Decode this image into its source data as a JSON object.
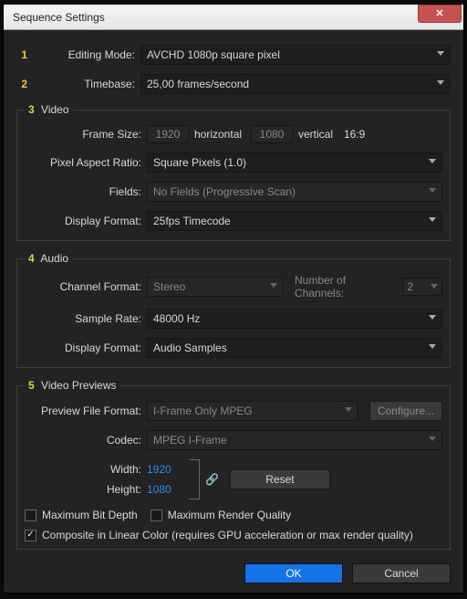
{
  "window": {
    "title": "Sequence Settings"
  },
  "markers": {
    "m1": "1",
    "m2": "2",
    "m3": "3",
    "m4": "4",
    "m5": "5"
  },
  "editing_mode": {
    "label": "Editing Mode:",
    "value": "AVCHD 1080p square pixel"
  },
  "timebase": {
    "label": "Timebase:",
    "value": "25,00 frames/second"
  },
  "video": {
    "legend": "Video",
    "frame_size": {
      "label": "Frame Size:",
      "w": "1920",
      "h": "1080",
      "horizontal": "horizontal",
      "vertical": "vertical",
      "aspect": "16:9"
    },
    "par": {
      "label": "Pixel Aspect Ratio:",
      "value": "Square Pixels (1.0)"
    },
    "fields": {
      "label": "Fields:",
      "value": "No Fields (Progressive Scan)"
    },
    "display_format": {
      "label": "Display Format:",
      "value": "25fps Timecode"
    }
  },
  "audio": {
    "legend": "Audio",
    "channel_format": {
      "label": "Channel Format:",
      "value": "Stereo"
    },
    "noc": {
      "label": "Number of Channels:",
      "value": "2"
    },
    "sample_rate": {
      "label": "Sample Rate:",
      "value": "48000 Hz"
    },
    "display_format": {
      "label": "Display Format:",
      "value": "Audio Samples"
    }
  },
  "previews": {
    "legend": "Video Previews",
    "format": {
      "label": "Preview File Format:",
      "value": "I-Frame Only MPEG"
    },
    "configure": "Configure...",
    "codec": {
      "label": "Codec:",
      "value": "MPEG I-Frame"
    },
    "width": {
      "label": "Width:",
      "value": "1920"
    },
    "height": {
      "label": "Height:",
      "value": "1080"
    },
    "reset": "Reset",
    "max_bit_depth": "Maximum Bit Depth",
    "max_render_quality": "Maximum Render Quality",
    "composite": "Composite in Linear Color (requires GPU acceleration or max render quality)"
  },
  "buttons": {
    "ok": "OK",
    "cancel": "Cancel"
  }
}
